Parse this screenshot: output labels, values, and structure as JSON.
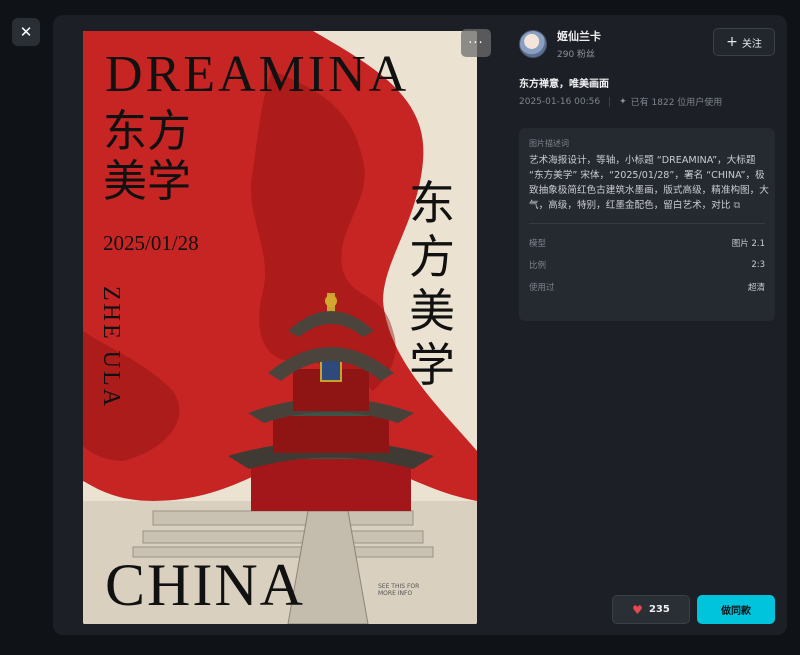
{
  "close": {
    "icon": "close-icon",
    "glyph": "✕"
  },
  "more": {
    "icon": "more-icon",
    "glyph": "···"
  },
  "poster": {
    "title_en": "DREAMINA",
    "subtitle_cn": "东方美学",
    "date": "2025/01/28",
    "vertical_latin": "ZHE ULA",
    "vertical_cn": "东方美学",
    "footer_en": "CHINA",
    "small_note": "SEE THIS FOR MORE INFO"
  },
  "author": {
    "name": "姬仙兰卡",
    "fans": "290 粉丝"
  },
  "follow": {
    "label": "关注",
    "icon": "plus-icon"
  },
  "image_title": "东方禅意，唯美画面",
  "meta": {
    "date": "2025-01-16 00:56",
    "usage": "已有 1822 位用户使用"
  },
  "info": {
    "label": "图片描述词",
    "prompt": "艺术海报设计，等轴，小标题 “DREAMINA”，大标题 “东方美学” 宋体，“2025/01/28”，署名 “CHINA”，极致抽象极简红色古建筑水墨画，版式高级，精准构图，大气，高级，特别，红墨金配色，留白艺术，对比",
    "params": [
      {
        "key": "模型",
        "value": "图片 2.1"
      },
      {
        "key": "比例",
        "value": "2:3"
      },
      {
        "key": "使用过",
        "value": "超清"
      }
    ]
  },
  "actions": {
    "like_count": "235",
    "same_label": "做同款"
  },
  "colors": {
    "accent": "#00c4dc",
    "heart": "#e5484d",
    "poster_red": "#c41a1a"
  }
}
